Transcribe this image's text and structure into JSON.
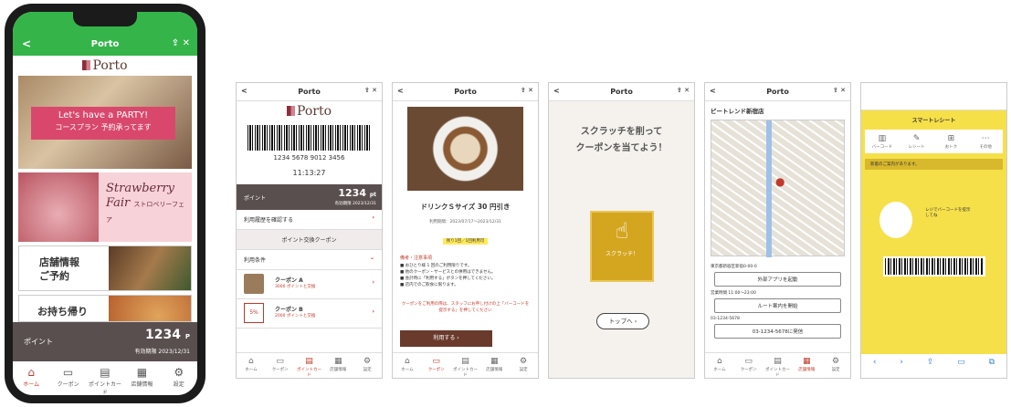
{
  "phone": {
    "title": "Porto",
    "back": "<",
    "actions": "⇪ ✕",
    "logo": "Porto",
    "banner1": {
      "title": "Let's have a PARTY!",
      "sub": "コースプラン 予約承ってます"
    },
    "banner2": {
      "title1": "Strawberry",
      "title2": "Fair",
      "sub": "ストロベリーフェア"
    },
    "banner3": "店舗情報\nご予約",
    "banner4": "お持ち帰り",
    "point_label": "ポイント",
    "point_value": "1234",
    "point_unit": "P",
    "point_expiry": "有効期限 2023/12/31",
    "tabs": [
      "ホーム",
      "クーポン",
      "ポイントカード",
      "店舗情報",
      "設定"
    ]
  },
  "s2": {
    "title": "Porto",
    "logo": "Porto",
    "code": "1234 5678 9012 3456",
    "time": "11:13:27",
    "point_label": "ポイント",
    "point_value": "1234",
    "point_unit": "pt",
    "expiry": "有効期限 2023/12/31",
    "history": "利用履歴を確認する",
    "exchange": "ポイント交換クーポン",
    "conditions": "利用条件",
    "coupon_a": "クーポン A",
    "coupon_a_pts": "3000 ポイントと交換",
    "coupon_b": "クーポン B",
    "coupon_b_pts": "2000 ポイントと交換",
    "tabs": [
      "ホーム",
      "クーポン",
      "ポイントカード",
      "店舗情報",
      "設定"
    ]
  },
  "s3": {
    "title": "Porto",
    "coupon": "ドリンクＳサイズ 30 円引き",
    "period": "利用期間：2023/07/17～2023/12/31",
    "badge": "残り1回／1回利用可",
    "notes_h": "備考・注意事項",
    "notes": [
      "■ おひとり様 1 回のご利用限りです。",
      "■ 他のクーポン・サービスとの併用はできません。",
      "■ 会計時に「利用する」ボタンを押してください。",
      "■ 店内でのご飲食に限ります。"
    ],
    "warn": "クーポンをご利用の際は、スタッフにお申し付けの上「バーコードを提示する」を押してください",
    "use": "利用する",
    "tabs": [
      "ホーム",
      "クーポン",
      "ポイントカード",
      "店舗情報",
      "設定"
    ]
  },
  "s4": {
    "title": "Porto",
    "head1": "スクラッチを削って",
    "head2": "クーポンを当てよう！",
    "scratch": "スクラッチ！",
    "top": "トップへ"
  },
  "s5": {
    "title": "Porto",
    "store": "ピートレンド新宿店",
    "addr": "東京都新宿区新宿0-00-0",
    "b1": "外部アプリを起動",
    "hours": "営業時間 11:00～23:00",
    "b2": "ルート案内を開始",
    "tel": "03-1234-5678",
    "b3": "03-1234-5678に発信",
    "tabs": [
      "ホーム",
      "クーポン",
      "ポイントカード",
      "店舗情報",
      "設定"
    ]
  },
  "s6": {
    "brand": "スマートレシート",
    "menu": [
      "バーコード",
      "レシート",
      "おトク",
      "その他"
    ],
    "notice": "新着のご案内があります。",
    "bubble": "レジでバーコードを提示してね"
  }
}
